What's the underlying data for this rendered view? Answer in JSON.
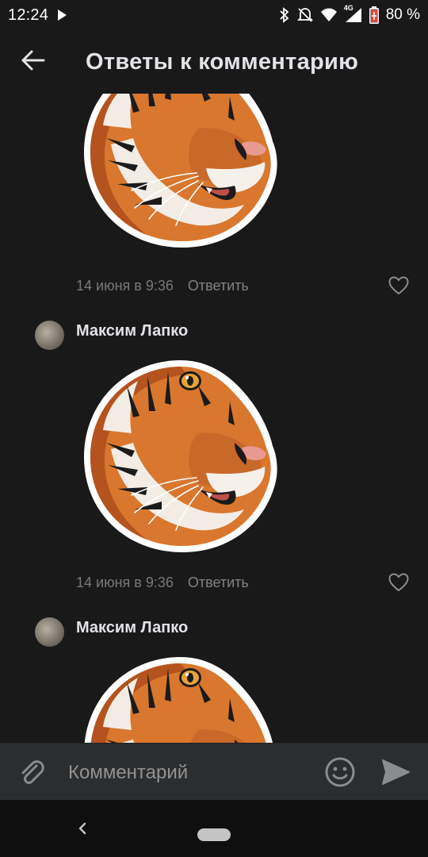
{
  "status_bar": {
    "time": "12:24",
    "network": "4G",
    "battery": "80 %"
  },
  "header": {
    "title": "Ответы к комментарию"
  },
  "comments": [
    {
      "author": "",
      "date": "14 июня в 9:36",
      "reply": "Ответить",
      "sticker": "tiger-sticker"
    },
    {
      "author": "Максим Лапко",
      "date": "14 июня в 9:36",
      "reply": "Ответить",
      "sticker": "tiger-sticker"
    },
    {
      "author": "Максим Лапко",
      "date": "",
      "reply": "",
      "sticker": "tiger-sticker"
    }
  ],
  "input": {
    "placeholder": "Комментарий"
  },
  "icons": [
    "back-arrow-icon",
    "attach-icon",
    "emoji-icon",
    "send-icon",
    "heart-icon",
    "bluetooth-icon",
    "bell-off-icon",
    "wifi-icon",
    "signal-icon",
    "battery-icon",
    "play-icon"
  ],
  "colors": {
    "background": "#19191a",
    "input_bar": "#2c2d2e",
    "text": "#e1e3e6",
    "secondary_text": "#76787a"
  }
}
